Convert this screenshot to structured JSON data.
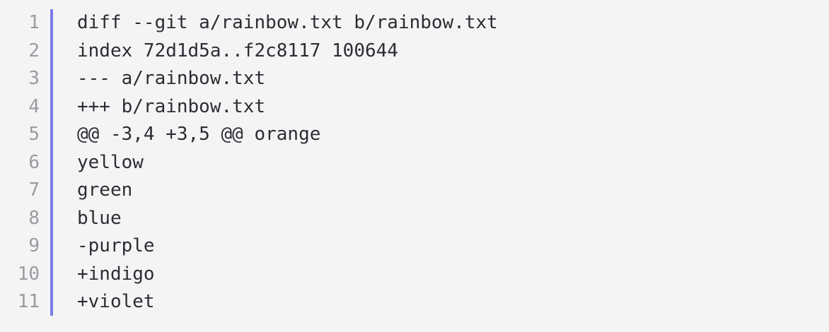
{
  "diff": {
    "lines": [
      {
        "number": "1",
        "text": "diff --git a/rainbow.txt b/rainbow.txt"
      },
      {
        "number": "2",
        "text": "index 72d1d5a..f2c8117 100644"
      },
      {
        "number": "3",
        "text": "--- a/rainbow.txt"
      },
      {
        "number": "4",
        "text": "+++ b/rainbow.txt"
      },
      {
        "number": "5",
        "text": "@@ -3,4 +3,5 @@ orange"
      },
      {
        "number": "6",
        "text": "yellow"
      },
      {
        "number": "7",
        "text": "green"
      },
      {
        "number": "8",
        "text": "blue"
      },
      {
        "number": "9",
        "text": "-purple"
      },
      {
        "number": "10",
        "text": "+indigo"
      },
      {
        "number": "11",
        "text": "+violet"
      }
    ]
  },
  "colors": {
    "background": "#f4f4f5",
    "gutter_accent": "#7b7bea",
    "line_number": "#9a9aa2",
    "code_text": "#2c2d34"
  }
}
